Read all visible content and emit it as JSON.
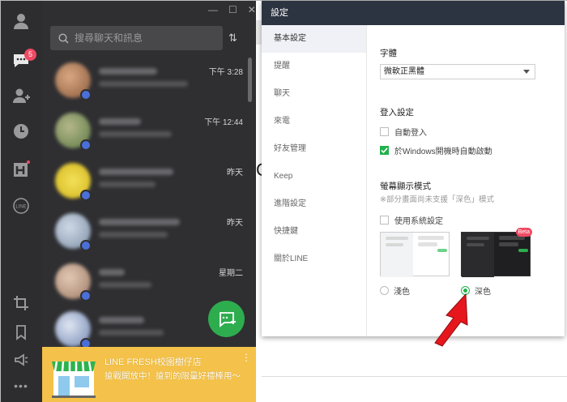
{
  "search": {
    "placeholder": "搜尋聊天和訊息"
  },
  "rail": {
    "unread_count": "5"
  },
  "chats": [
    {
      "time": "下午 3:28"
    },
    {
      "time": "下午 12:44"
    },
    {
      "time": "昨天"
    },
    {
      "time": "昨天"
    },
    {
      "time": "星期二"
    },
    {
      "time": ""
    }
  ],
  "banner": {
    "title": "LINE FRESH校園樹仔店",
    "text": "搶戰開放中！搶到的限量好禮棒用～"
  },
  "settings": {
    "title": "設定",
    "nav": [
      "基本設定",
      "提醒",
      "聊天",
      "來電",
      "好友管理",
      "Keep",
      "進階設定",
      "快捷鍵",
      "關於LINE"
    ],
    "font_label": "字體",
    "font_value": "微軟正黑體",
    "login_label": "登入設定",
    "auto_login": "自動登入",
    "auto_start": "於Windows開機時自動啟動",
    "display_label": "螢幕顯示模式",
    "display_note": "※部分畫面尚未支援「深色」模式",
    "use_system": "使用系統設定",
    "light": "淺色",
    "dark": "深色",
    "beta": "Beta"
  },
  "bg_partial": {
    "char1": "搜",
    "char2": "C"
  }
}
